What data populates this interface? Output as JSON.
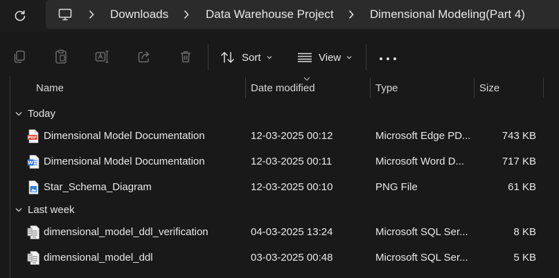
{
  "address_bar": {
    "breadcrumbs": [
      "Downloads",
      "Data Warehouse Project",
      "Dimensional Modeling(Part 4)"
    ]
  },
  "command_bar": {
    "sort_label": "Sort",
    "view_label": "View"
  },
  "columns": {
    "name": "Name",
    "date_modified": "Date modified",
    "type": "Type",
    "size": "Size"
  },
  "groups": [
    {
      "label": "Today",
      "files": [
        {
          "icon": "pdf-file-icon",
          "name": "Dimensional Model Documentation",
          "date": "12-03-2025 00:12",
          "type": "Microsoft Edge PDF Document",
          "size": "743 KB"
        },
        {
          "icon": "word-file-icon",
          "name": "Dimensional Model Documentation",
          "date": "12-03-2025 00:11",
          "type": "Microsoft Word Document",
          "size": "717 KB"
        },
        {
          "icon": "png-file-icon",
          "name": "Star_Schema_Diagram",
          "date": "12-03-2025 00:10",
          "type": "PNG File",
          "size": "61 KB"
        }
      ]
    },
    {
      "label": "Last week",
      "files": [
        {
          "icon": "sql-file-icon",
          "name": "dimensional_model_ddl_verification",
          "date": "04-03-2025 13:24",
          "type": "Microsoft SQL Server Query File",
          "size": "8 KB"
        },
        {
          "icon": "sql-file-icon",
          "name": "dimensional_model_ddl",
          "date": "03-03-2025 00:48",
          "type": "Microsoft SQL Server Query File",
          "size": "5 KB"
        }
      ]
    }
  ],
  "type_display": [
    "Microsoft Edge PD...",
    "Microsoft Word D...",
    "PNG File",
    "Microsoft SQL Ser...",
    "Microsoft SQL Ser..."
  ],
  "colors": {
    "background": "#191919",
    "address_box": "#2b2b2b",
    "pdf_red": "#d83b2e",
    "word_blue": "#2b6cd4",
    "text": "#e8e8e8",
    "disabled_icon": "#6b6b6b"
  }
}
